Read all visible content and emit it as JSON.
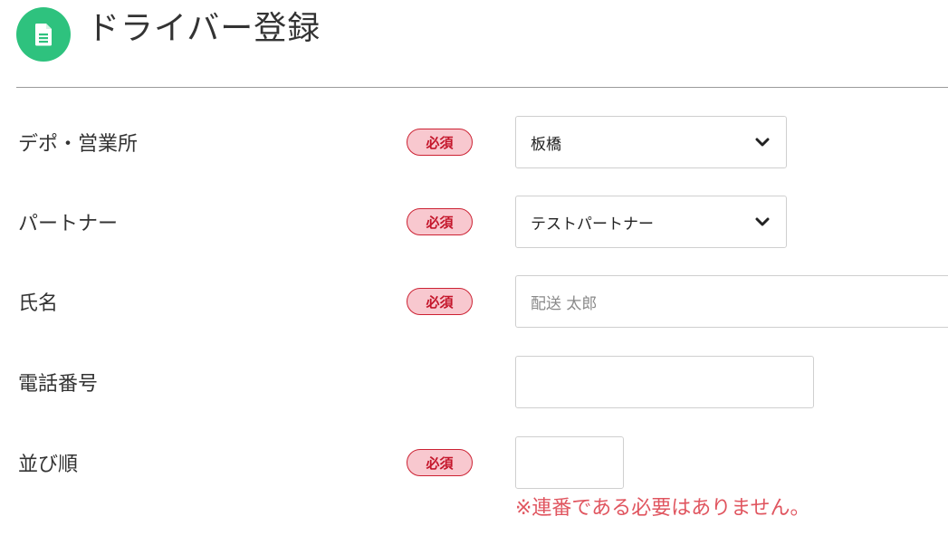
{
  "page": {
    "title": "ドライバー登録",
    "icon": "document-icon",
    "accent_color": "#2ec27e"
  },
  "badge_label": "必須",
  "form": {
    "depot": {
      "label": "デポ・営業所",
      "required": true,
      "value": "板橋"
    },
    "partner": {
      "label": "パートナー",
      "required": true,
      "value": "テストパートナー"
    },
    "name": {
      "label": "氏名",
      "required": true,
      "placeholder": "配送 太郎",
      "value": ""
    },
    "phone": {
      "label": "電話番号",
      "required": false,
      "value": ""
    },
    "order": {
      "label": "並び順",
      "required": true,
      "value": "",
      "note": "※連番である必要はありません。"
    }
  }
}
